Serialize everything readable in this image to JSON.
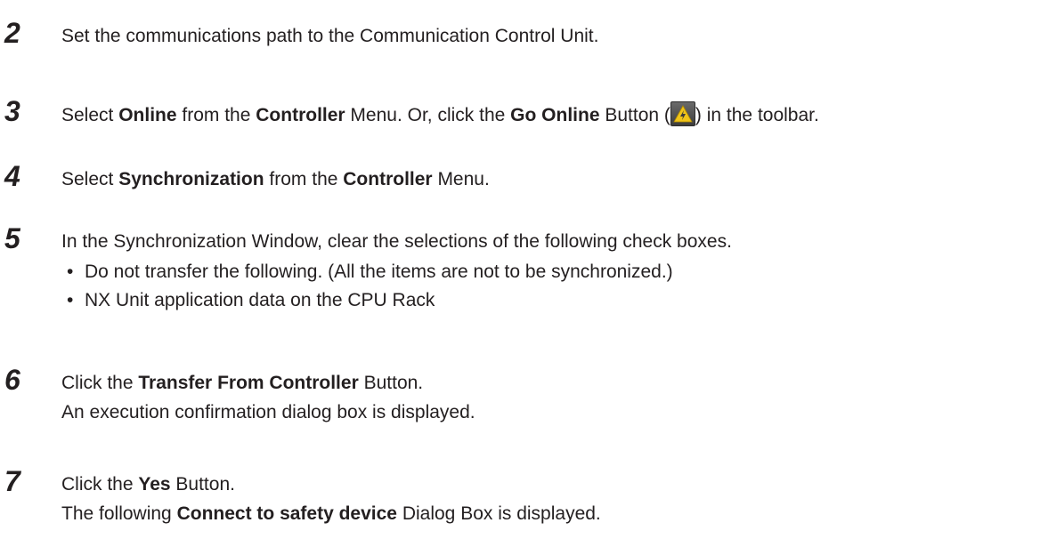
{
  "steps": [
    {
      "number": "2",
      "text": "Set the communications path to the Communication Control Unit."
    },
    {
      "number": "3",
      "parts": [
        "Select ",
        "Online",
        " from the ",
        "Controller",
        " Menu. Or, click the ",
        "Go Online",
        " Button (",
        ") in the toolbar."
      ],
      "icon": "go-online-icon"
    },
    {
      "number": "4",
      "parts": [
        "Select ",
        "Synchronization",
        " from the ",
        "Controller",
        " Menu."
      ]
    },
    {
      "number": "5",
      "text": "In the Synchronization Window, clear the selections of the following check boxes.",
      "bullets": [
        "Do not transfer the following. (All the items are not to be synchronized.)",
        "NX Unit application data on the CPU Rack"
      ],
      "bullet_char": "•"
    },
    {
      "number": "6",
      "parts": [
        "Click the ",
        "Transfer From Controller",
        " Button."
      ],
      "line2": "An execution confirmation dialog box is displayed."
    },
    {
      "number": "7",
      "parts": [
        "Click the ",
        "Yes",
        " Button."
      ],
      "line2_parts": [
        "The following ",
        "Connect to safety device",
        " Dialog Box is displayed."
      ]
    }
  ],
  "colors": {
    "text": "#231f20",
    "icon_background": "#4a4a4a",
    "icon_warning": "#f0c419"
  }
}
